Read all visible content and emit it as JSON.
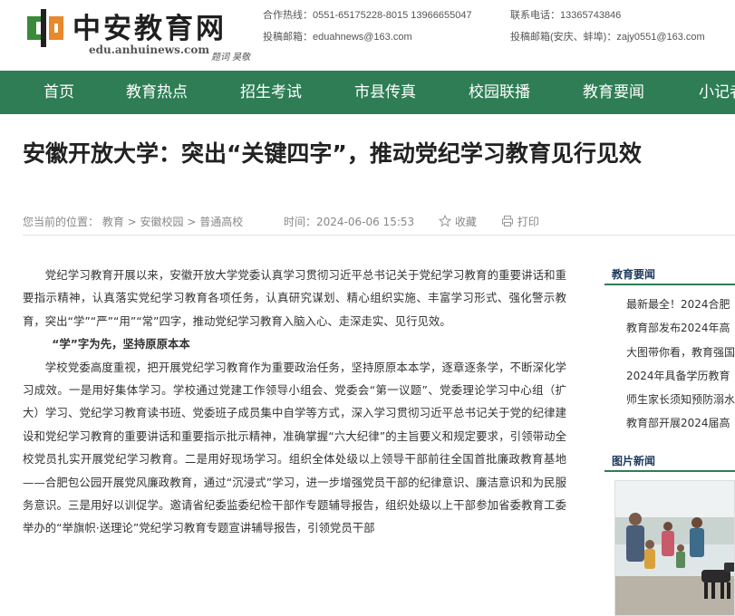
{
  "header": {
    "logo_title": "中安教育网",
    "logo_url": "edu.anhuinews.com",
    "logo_sign": "题词 吴敬",
    "hotline": "合作热线：0551-65175228-8015 13966655047",
    "phone": "联系电话：13365743846",
    "email": "投稿邮箱：eduahnews@163.com",
    "email2": "投稿邮箱(安庆、蚌埠)：zajy0551@163.com"
  },
  "nav": [
    "首页",
    "教育热点",
    "招生考试",
    "市县传真",
    "校园联播",
    "教育要闻",
    "小记者"
  ],
  "article": {
    "title": "安徽开放大学：突出“关键四字”，推动党纪学习教育见行见效",
    "location_label": "您当前的位置",
    "breadcrumb": "：  教育 > 安徽校园 > 普通高校",
    "time": "时间：2024-06-06 15:53",
    "favorite": "收藏",
    "print": "打印",
    "p1": "党纪学习教育开展以来，安徽开放大学党委认真学习贯彻习近平总书记关于党纪学习教育的重要讲话和重要指示精神，认真落实党纪学习教育各项任务，认真研究谋划、精心组织实施、丰富学习形式、强化警示教育，突出“学”“严”“用”“常”四字，推动党纪学习教育入脑入心、走深走实、见行见效。",
    "subhead1": "“学”字为先，坚持原原本本",
    "p2": "学校党委高度重视，把开展党纪学习教育作为重要政治任务，坚持原原本本学，逐章逐条学，不断深化学习成效。一是用好集体学习。学校通过党建工作领导小组会、党委会“第一议题”、党委理论学习中心组（扩大）学习、党纪学习教育读书班、党委班子成员集中自学等方式，深入学习贯彻习近平总书记关于党的纪律建设和党纪学习教育的重要讲话和重要指示批示精神，准确掌握“六大纪律”的主旨要义和规定要求，引领带动全校党员扎实开展党纪学习教育。二是用好现场学习。组织全体处级以上领导干部前往全国首批廉政教育基地——合肥包公园开展党风廉政教育，通过“沉浸式”学习，进一步增强党员干部的纪律意识、廉洁意识和为民服务意识。三是用好以训促学。邀请省纪委监委纪检干部作专题辅导报告，组织处级以上干部参加省委教育工委举办的“举旗帜·送理论”党纪学习教育专题宣讲辅导报告，引领党员干部"
  },
  "sidebar": {
    "news_heading": "教育要闻",
    "news": [
      "最新最全！2024合肥",
      "教育部发布2024年高",
      "大图带你看，教育强国",
      "2024年具备学历教育",
      "师生家长须知预防溺水",
      "教育部开展2024届高"
    ],
    "photo_heading": "图片新闻"
  },
  "colors": {
    "nav_bg": "#2e7d55",
    "logo_green": "#3a8a3a",
    "logo_orange": "#e7892d"
  }
}
